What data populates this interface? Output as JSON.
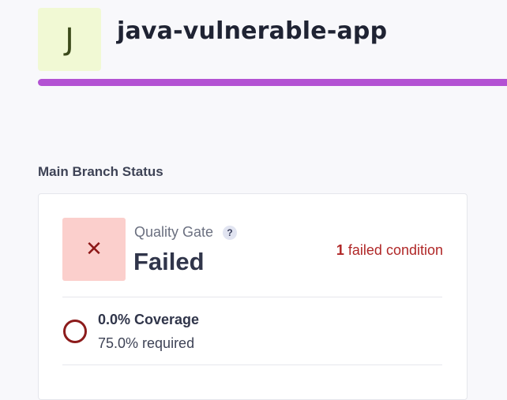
{
  "project": {
    "avatar_letter": "J",
    "name": "java-vulnerable-app",
    "accent_color": "#b352d3"
  },
  "main_branch": {
    "section_title": "Main Branch Status",
    "quality_gate": {
      "status_icon": "close-icon",
      "label": "Quality Gate",
      "help_symbol": "?",
      "status": "Failed",
      "failed_count": "1",
      "failed_text": "failed condition",
      "status_color": "#b02727"
    },
    "conditions": [
      {
        "icon": "failed-circle-icon",
        "title": "0.0% Coverage",
        "requirement": "75.0% required"
      }
    ]
  }
}
